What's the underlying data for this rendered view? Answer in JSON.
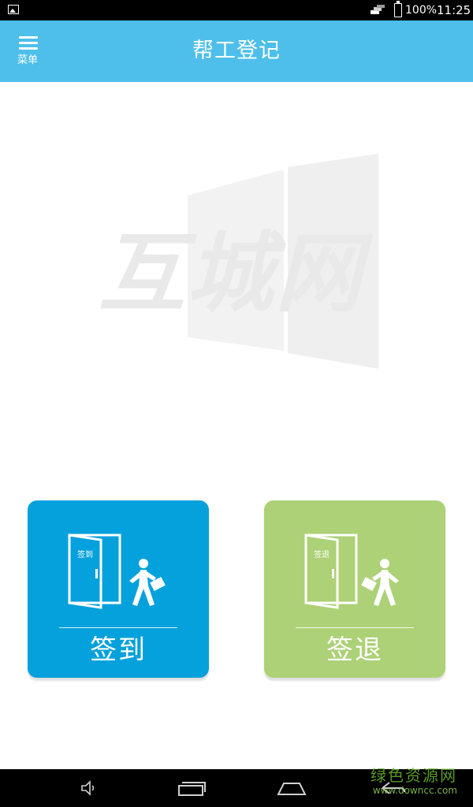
{
  "status_bar": {
    "battery": "100%",
    "time": "11:25",
    "icons": [
      "gallery-icon",
      "signal-icon",
      "battery-icon"
    ]
  },
  "app_bar": {
    "menu_label": "菜单",
    "title": "帮工登记",
    "color": "#4dbfea"
  },
  "logo": {
    "text": "互城网"
  },
  "cards": {
    "checkin": {
      "label": "签到",
      "door_label": "签到",
      "color": "#05a1dc"
    },
    "checkout": {
      "label": "签退",
      "door_label": "签退",
      "color": "#acd176"
    }
  },
  "nav_bar": {
    "icons": [
      "volume-icon",
      "recent-apps-icon",
      "home-icon",
      "back-icon"
    ]
  },
  "watermark": {
    "site_name": "绿色资源网",
    "site_url": "www.downcc.com"
  }
}
